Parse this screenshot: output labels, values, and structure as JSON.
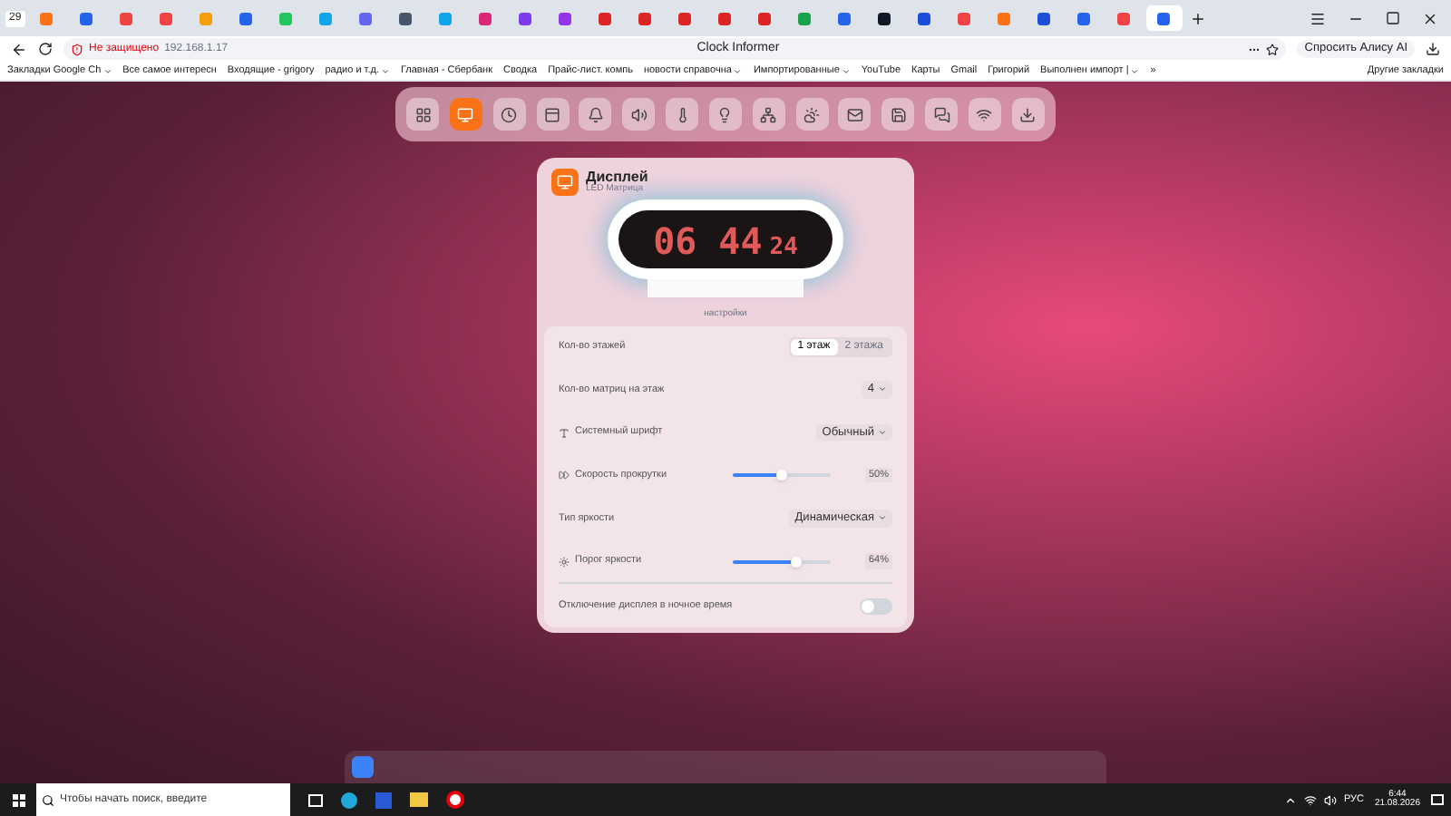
{
  "browser": {
    "tab_count": "29",
    "tabs": [
      {
        "color": "#f97316",
        "selected": false
      },
      {
        "color": "#2563eb",
        "selected": false
      },
      {
        "color": "#ef4444",
        "selected": false
      },
      {
        "color": "#ef4444",
        "selected": false
      },
      {
        "color": "#f59e0b",
        "selected": false
      },
      {
        "color": "#2563eb",
        "selected": false
      },
      {
        "color": "#22c55e",
        "selected": false
      },
      {
        "color": "#0ea5e9",
        "selected": false
      },
      {
        "color": "#6366f1",
        "selected": false
      },
      {
        "color": "#475569",
        "selected": false
      },
      {
        "color": "#0ea5e9",
        "selected": false
      },
      {
        "color": "#db2777",
        "selected": false
      },
      {
        "color": "#7c3aed",
        "selected": false
      },
      {
        "color": "#9333ea",
        "selected": false
      },
      {
        "color": "#dc2626",
        "selected": false
      },
      {
        "color": "#dc2626",
        "selected": false
      },
      {
        "color": "#dc2626",
        "selected": false
      },
      {
        "color": "#dc2626",
        "selected": false
      },
      {
        "color": "#dc2626",
        "selected": false
      },
      {
        "color": "#16a34a",
        "selected": false
      },
      {
        "color": "#2563eb",
        "selected": false
      },
      {
        "color": "#111827",
        "selected": false
      },
      {
        "color": "#1d4ed8",
        "selected": false
      },
      {
        "color": "#ef4444",
        "selected": false
      },
      {
        "color": "#f97316",
        "selected": false
      },
      {
        "color": "#1d4ed8",
        "selected": false
      },
      {
        "color": "#2563eb",
        "selected": false
      },
      {
        "color": "#ef4444",
        "selected": false
      },
      {
        "color": "#2563eb",
        "selected": true
      }
    ],
    "security": "Не защищено",
    "url": "192.168.1.17",
    "page_title": "Clock Informer",
    "alice": "Спросить Алису AI",
    "bookmarks": [
      {
        "label": "Закладки Google Ch",
        "folder": true
      },
      {
        "label": "Все самое интересн",
        "folder": false
      },
      {
        "label": "Входящие - grigory",
        "folder": false
      },
      {
        "label": "радио и т.д.",
        "folder": true
      },
      {
        "label": "Главная - Сбербанк",
        "folder": false
      },
      {
        "label": "Сводка",
        "folder": false
      },
      {
        "label": "Прайс-лист. компь",
        "folder": false
      },
      {
        "label": "новости справочна",
        "folder": true
      },
      {
        "label": "Импортированные",
        "folder": true
      },
      {
        "label": "YouTube",
        "folder": false
      },
      {
        "label": "Карты",
        "folder": false
      },
      {
        "label": "Gmail",
        "folder": false
      },
      {
        "label": "Григорий",
        "folder": false
      },
      {
        "label": "Выполнен импорт |",
        "folder": true
      }
    ],
    "more": "»",
    "other_bookmarks": "Другие закладки"
  },
  "toolbar": [
    {
      "selected": false
    },
    {
      "selected": true
    },
    {
      "selected": false
    },
    {
      "selected": false
    },
    {
      "selected": false
    },
    {
      "selected": false
    },
    {
      "selected": false
    },
    {
      "selected": false
    },
    {
      "selected": false
    },
    {
      "selected": false
    },
    {
      "selected": false
    },
    {
      "selected": false
    },
    {
      "selected": false
    },
    {
      "selected": false
    },
    {
      "selected": false
    }
  ],
  "card": {
    "title": "Дисплей",
    "subtitle": "LED Матрица",
    "clock": {
      "main": "06 44",
      "seconds": "24"
    },
    "section": "настройки",
    "settings": [
      {
        "kind": "segmented",
        "label": "Кол-во этажей",
        "options": [
          {
            "label": "1 этаж",
            "selected": true
          },
          {
            "label": "2 этажа",
            "selected": false
          }
        ]
      },
      {
        "kind": "select",
        "label": "Кол-во матриц на этаж",
        "value": "4"
      },
      {
        "kind": "select",
        "label": "Системный шрифт",
        "value": "Обычный"
      },
      {
        "kind": "slider",
        "label": "Скорость прокрутки",
        "level": 0.5,
        "reading": "50%"
      },
      {
        "kind": "select",
        "label": "Тип яркости",
        "value": "Динамическая"
      },
      {
        "kind": "slider",
        "label": "Порог яркости",
        "level": 0.64,
        "reading": "64%"
      },
      {
        "kind": "toggle",
        "label": "Отключение дисплея в ночное время",
        "on": false
      }
    ]
  },
  "taskbar": {
    "search_placeholder": "Чтобы начать поиск, введите",
    "language": "РУС",
    "time": "6:44",
    "date": "21.08.2026"
  }
}
